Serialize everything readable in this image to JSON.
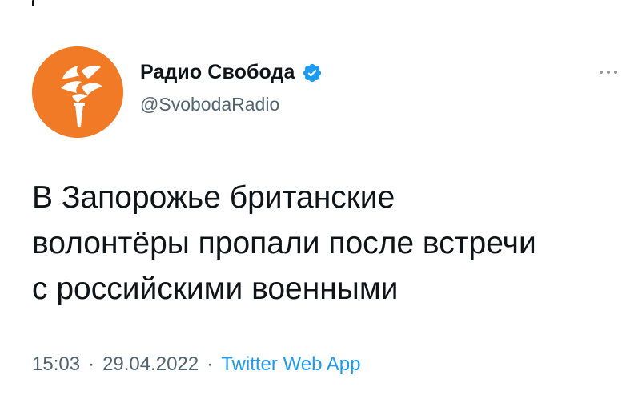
{
  "account": {
    "display_name": "Радио Свобода",
    "handle": "@SvobodaRadio",
    "verified": true,
    "avatar_icon": "rfe-rl-torch-logo-icon",
    "avatar_color": "#f07a26"
  },
  "tweet": {
    "text": "В Запорожье британские\nволонтёры пропали после встречи\nс российскими военными"
  },
  "meta": {
    "time": "15:03",
    "separator": "·",
    "date": "29.04.2022",
    "source": "Twitter Web App"
  },
  "icons": {
    "verified": "verified-badge-icon",
    "more": "more-options-icon"
  },
  "colors": {
    "verified_blue": "#1d9bf0",
    "link_blue": "#1d9bf0",
    "secondary_text": "#536471"
  }
}
